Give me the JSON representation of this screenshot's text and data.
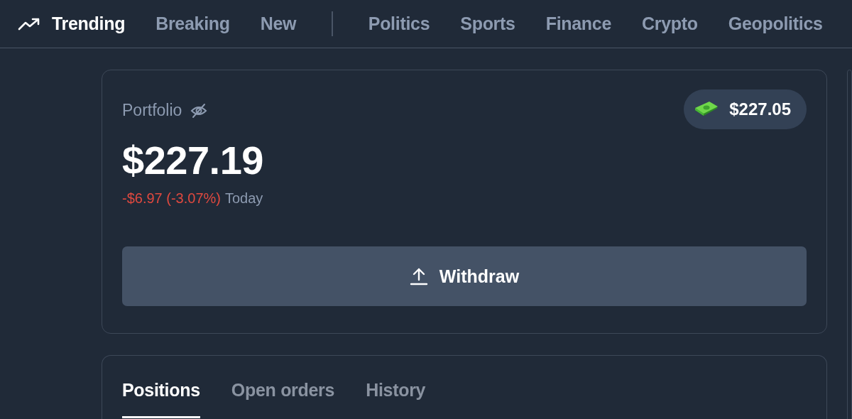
{
  "nav": {
    "tabs": [
      {
        "label": "Trending",
        "kind": "trend",
        "selected": true
      },
      {
        "label": "Breaking",
        "kind": "plain",
        "selected": false
      },
      {
        "label": "New",
        "kind": "plain",
        "selected": false
      }
    ],
    "categories": [
      "Politics",
      "Sports",
      "Finance",
      "Crypto",
      "Geopolitics"
    ]
  },
  "portfolio": {
    "title": "Portfolio",
    "value": "$227.19",
    "change": "-$6.97 (-3.07%)",
    "period": "Today",
    "cash": "$227.05",
    "withdraw": "Withdraw"
  },
  "positions": {
    "tabs": [
      {
        "label": "Positions",
        "selected": true
      },
      {
        "label": "Open orders",
        "selected": false
      },
      {
        "label": "History",
        "selected": false
      }
    ]
  }
}
